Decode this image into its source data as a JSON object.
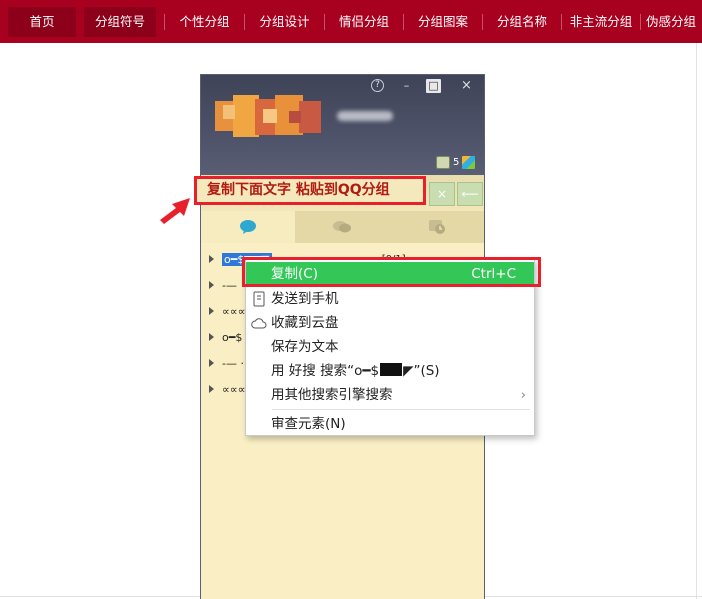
{
  "nav": {
    "items": [
      "首页",
      "分组符号",
      "个性分组",
      "分组设计",
      "情侣分组",
      "分组图案",
      "分组名称",
      "非主流分组",
      "伪感分组"
    ],
    "active_index": 1
  },
  "qq": {
    "window_buttons": [
      "?",
      "–",
      "□",
      "×"
    ],
    "status_count": "5",
    "callout": "复制下面文字  粘贴到QQ分组",
    "group_rows": [
      {
        "text": "o━$▆▆◤",
        "count": "[0/1]"
      },
      {
        "text": "-— ",
        "count": ""
      },
      {
        "text": "∝∝∝",
        "count": ""
      },
      {
        "text": "o━$",
        "count": ""
      },
      {
        "text": "-— ·",
        "count": ""
      },
      {
        "text": "∝∝∝",
        "count": ""
      }
    ]
  },
  "context_menu": {
    "items": [
      {
        "label": "复制(C)",
        "shortcut": "Ctrl+C"
      },
      {
        "label": "发送到手机"
      },
      {
        "label": "收藏到云盘"
      },
      {
        "label": "保存为文本"
      },
      {
        "label_prefix": "用 好搜 搜索“o━$",
        "label_suffix": "◤”(S)"
      },
      {
        "label": "用其他搜索引擎搜索",
        "submenu": "›"
      },
      {
        "label": "审查元素(N)"
      }
    ]
  },
  "colors": {
    "nav_bg": "#a8001f",
    "highlight_green": "#33c758",
    "annotation_red": "#e8202b"
  }
}
